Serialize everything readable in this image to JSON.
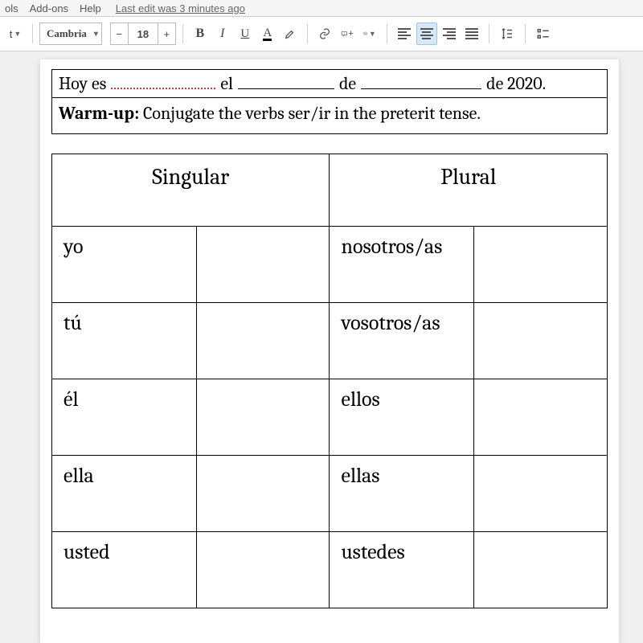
{
  "menubar": {
    "items": [
      "ols",
      "Add-ons",
      "Help"
    ],
    "edit_status": "Last edit was 3 minutes ago"
  },
  "toolbar": {
    "initial_btn": "t",
    "font_name": "Cambria",
    "font_size": "18",
    "minus": "−",
    "plus": "+",
    "bold": "B",
    "italic": "I",
    "underline": "U",
    "text_color": "A"
  },
  "doc": {
    "date_line": {
      "prefix": "Hoy es",
      "part_el": "el",
      "part_de1": "de",
      "part_de2": "de 2020."
    },
    "warmup": {
      "label": "Warm-up:",
      "text": " Conjugate the verbs ser/ir in the preterit tense."
    },
    "table": {
      "col_singular": "Singular",
      "col_plural": "Plural",
      "rows": [
        {
          "sg": "yo",
          "pl": "nosotros/as"
        },
        {
          "sg": "tú",
          "pl": "vosotros/as"
        },
        {
          "sg": "él",
          "pl": "ellos"
        },
        {
          "sg": "ella",
          "pl": "ellas"
        },
        {
          "sg": "usted",
          "pl": "ustedes"
        }
      ]
    }
  }
}
